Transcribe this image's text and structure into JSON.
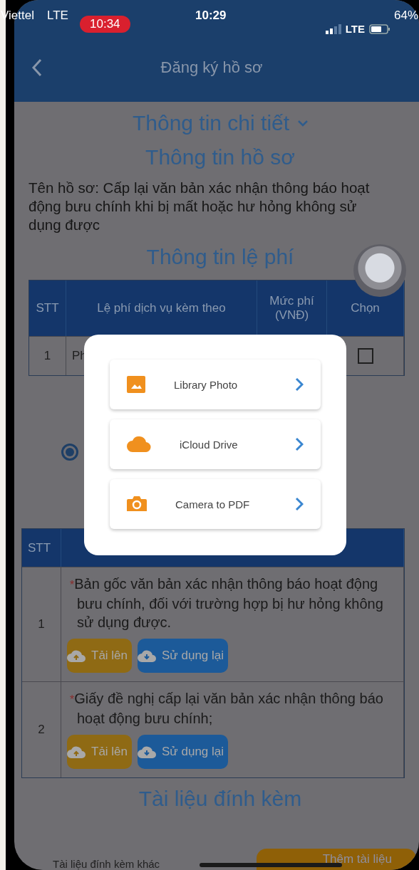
{
  "status_bar": {
    "carrier": "Viettel",
    "network_left": "LTE",
    "recording_time": "10:34",
    "time": "10:29",
    "network": "LTE",
    "battery": "64%"
  },
  "header": {
    "title": "Đăng ký hồ sơ"
  },
  "details_title": "Thông tin chi tiết",
  "profile": {
    "title": "Thông tin hồ sơ",
    "description": "Tên hồ sơ: Cấp lại văn bản xác nhận thông báo hoạt động bưu chính khi bị mất hoặc hư hỏng không sử dụng được"
  },
  "fees": {
    "title": "Thông tin lệ phí",
    "columns": [
      "STT",
      "Lệ phí dịch vụ kèm theo",
      "Mức phí (VNĐ)",
      "Chọn"
    ],
    "rows": [
      {
        "stt": "1",
        "service": "Ph",
        "checked": false
      }
    ]
  },
  "payment_options": [
    {
      "selected": true
    }
  ],
  "documents": {
    "columns": [
      "STT"
    ],
    "rows": [
      {
        "stt": "1",
        "required_mark": "*",
        "name": "Bản gốc văn bản xác nhận thông báo hoạt động bưu chính, đối với trường hợp bị hư hỏng không sử dụng được.",
        "upload_label": "Tải lên",
        "reuse_label": "Sử dụng lại"
      },
      {
        "stt": "2",
        "required_mark": "*",
        "name": "Giấy đề nghị cấp lại văn bản xác nhận thông báo hoạt động bưu chính;",
        "upload_label": "Tải lên",
        "reuse_label": "Sử dụng lại"
      }
    ]
  },
  "attachments": {
    "title": "Tài liệu đính kèm",
    "other_label": "Tài liệu đính kèm khác",
    "add_button": "Thêm tài liệu"
  },
  "picker": {
    "options": [
      {
        "kind": "photo",
        "label": "Library Photo"
      },
      {
        "kind": "cloud",
        "label": "iCloud Drive"
      },
      {
        "kind": "camera",
        "label": "Camera to PDF"
      }
    ]
  }
}
